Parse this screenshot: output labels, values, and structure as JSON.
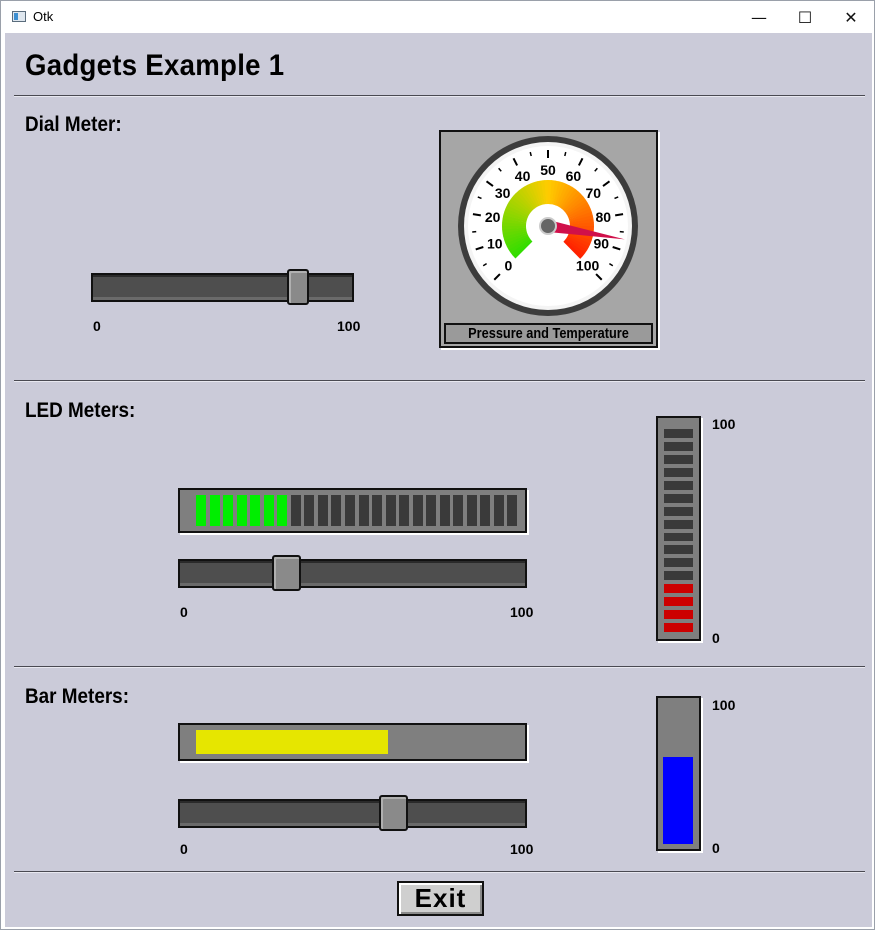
{
  "window": {
    "title": "Otk",
    "minimize": "—",
    "maximize": "☐",
    "close": "✕"
  },
  "heading": "Gadgets Example 1",
  "dial_section": {
    "label": "Dial Meter:",
    "slider": {
      "min_label": "0",
      "max_label": "100",
      "value": 82
    },
    "gauge": {
      "caption": "Pressure and Temperature",
      "scale_labels": [
        "0",
        "10",
        "20",
        "30",
        "40",
        "50",
        "60",
        "70",
        "80",
        "90",
        "100"
      ],
      "needle_value": 87,
      "colors": {
        "low": "#33dd00",
        "mid": "#ffcc00",
        "high": "#ff2200",
        "needle": "#d0104a"
      }
    }
  },
  "led_section": {
    "label": "LED Meters:",
    "horizontal_meter": {
      "segments": 24,
      "lit": 7,
      "lit_color": "#00ee00",
      "unlit_color": "#3a3a3a"
    },
    "slider": {
      "min_label": "0",
      "max_label": "100",
      "value": 29
    },
    "vertical_meter": {
      "segments": 16,
      "lit": 4,
      "lit_color": "#cc0000",
      "unlit_color": "#3a3a3a",
      "max_label": "100",
      "min_label": "0"
    }
  },
  "bar_section": {
    "label": "Bar Meters:",
    "horizontal_bar": {
      "value": 59,
      "color": "#e6e600"
    },
    "slider": {
      "min_label": "0",
      "max_label": "100",
      "value": 63
    },
    "vertical_bar": {
      "value": 62,
      "color": "#0000ff",
      "max_label": "100",
      "min_label": "0"
    }
  },
  "exit_label": "Exit"
}
